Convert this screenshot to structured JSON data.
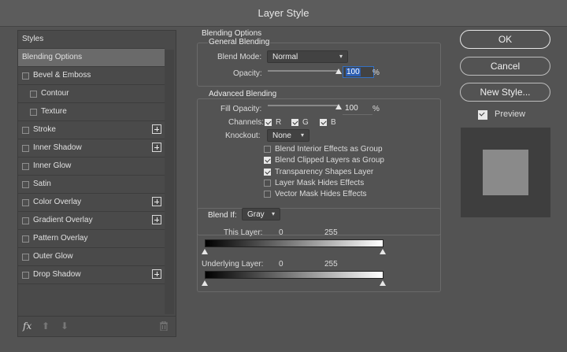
{
  "window": {
    "title": "Layer Style"
  },
  "styles_panel": {
    "header": "Styles",
    "items": [
      {
        "label": "Blending Options",
        "checkbox": false,
        "selected": true,
        "indent": 0,
        "add": false
      },
      {
        "label": "Bevel & Emboss",
        "checkbox": true,
        "checked": false,
        "indent": 0,
        "add": false
      },
      {
        "label": "Contour",
        "checkbox": true,
        "checked": false,
        "indent": 1,
        "add": false
      },
      {
        "label": "Texture",
        "checkbox": true,
        "checked": false,
        "indent": 1,
        "add": false
      },
      {
        "label": "Stroke",
        "checkbox": true,
        "checked": false,
        "indent": 0,
        "add": true
      },
      {
        "label": "Inner Shadow",
        "checkbox": true,
        "checked": false,
        "indent": 0,
        "add": true
      },
      {
        "label": "Inner Glow",
        "checkbox": true,
        "checked": false,
        "indent": 0,
        "add": false
      },
      {
        "label": "Satin",
        "checkbox": true,
        "checked": false,
        "indent": 0,
        "add": false
      },
      {
        "label": "Color Overlay",
        "checkbox": true,
        "checked": false,
        "indent": 0,
        "add": true
      },
      {
        "label": "Gradient Overlay",
        "checkbox": true,
        "checked": false,
        "indent": 0,
        "add": true
      },
      {
        "label": "Pattern Overlay",
        "checkbox": true,
        "checked": false,
        "indent": 0,
        "add": false
      },
      {
        "label": "Outer Glow",
        "checkbox": true,
        "checked": false,
        "indent": 0,
        "add": false
      },
      {
        "label": "Drop Shadow",
        "checkbox": true,
        "checked": false,
        "indent": 0,
        "add": true
      }
    ],
    "bottom_icons": [
      "fx-icon",
      "move-up-icon",
      "move-down-icon",
      "trash-icon"
    ],
    "fx_label": "fx"
  },
  "blending": {
    "section_title": "Blending Options",
    "general": {
      "title": "General Blending",
      "blend_mode_label": "Blend Mode:",
      "blend_mode_value": "Normal",
      "opacity_label": "Opacity:",
      "opacity_value": "100",
      "opacity_unit": "%",
      "opacity_level": 1.0
    },
    "advanced": {
      "title": "Advanced Blending",
      "fill_opacity_label": "Fill Opacity:",
      "fill_opacity_value": "100",
      "fill_opacity_unit": "%",
      "fill_opacity_level": 1.0,
      "channels_label": "Channels:",
      "channels": [
        {
          "label": "R",
          "checked": true
        },
        {
          "label": "G",
          "checked": true
        },
        {
          "label": "B",
          "checked": true
        }
      ],
      "knockout_label": "Knockout:",
      "knockout_value": "None",
      "options": [
        {
          "label": "Blend Interior Effects as Group",
          "checked": false
        },
        {
          "label": "Blend Clipped Layers as Group",
          "checked": true
        },
        {
          "label": "Transparency Shapes Layer",
          "checked": true
        },
        {
          "label": "Layer Mask Hides Effects",
          "checked": false
        },
        {
          "label": "Vector Mask Hides Effects",
          "checked": false
        }
      ]
    },
    "blend_if": {
      "label": "Blend If:",
      "channel_value": "Gray",
      "this_layer_label": "This Layer:",
      "this_layer_min": "0",
      "this_layer_max": "255",
      "underlying_label": "Underlying Layer:",
      "underlying_min": "0",
      "underlying_max": "255"
    }
  },
  "buttons": {
    "ok": "OK",
    "cancel": "Cancel",
    "new_style": "New Style..."
  },
  "preview": {
    "label": "Preview",
    "checked": true
  },
  "colors": {
    "background": "#535353",
    "selected_row": "#6a6a6a",
    "focus": "#3471c4"
  }
}
